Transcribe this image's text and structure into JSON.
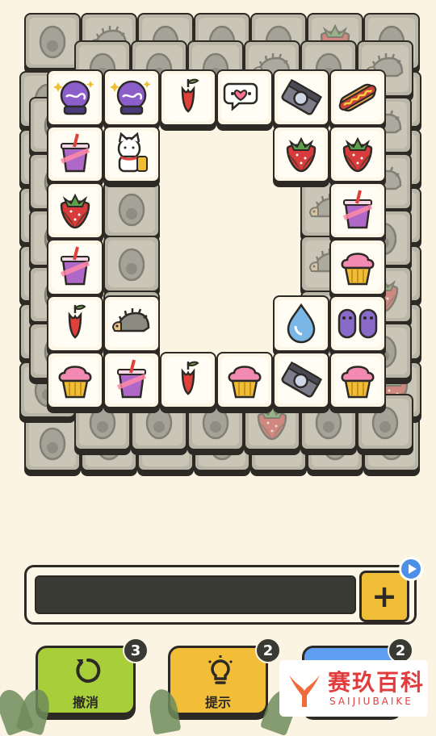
{
  "board": {
    "back_layer": [
      "avocado",
      "hedgehog",
      "cactus",
      "guitar",
      "avocado",
      "strawberry",
      "avocado",
      "cat",
      "avocado",
      "hedgehog"
    ],
    "top_layer": [
      {
        "icon": "crystal-ball-icon",
        "label": "crystal-ball"
      },
      {
        "icon": "crystal-ball-icon",
        "label": "crystal-ball"
      },
      {
        "icon": "red-flower-icon",
        "label": "red-flower"
      },
      {
        "icon": "chat-heart-icon",
        "label": "chat-heart"
      },
      {
        "icon": "camera-icon",
        "label": "camera"
      },
      {
        "icon": "hotdog-icon",
        "label": "hotdog"
      },
      {
        "icon": "bubble-tea-icon",
        "label": "bubble-tea"
      },
      {
        "icon": "lucky-cat-icon",
        "label": "lucky-cat"
      },
      {
        "icon": "strawberry-icon",
        "label": "strawberry"
      },
      {
        "icon": "strawberry-icon",
        "label": "strawberry"
      },
      {
        "icon": "strawberry-icon",
        "label": "strawberry"
      },
      {
        "icon": "bubble-tea-icon",
        "label": "bubble-tea"
      },
      {
        "icon": "bubble-tea-icon",
        "label": "bubble-tea"
      },
      {
        "icon": "cupcake-icon",
        "label": "cupcake"
      },
      {
        "icon": "red-flower-icon",
        "label": "red-flower"
      },
      {
        "icon": "hedgehog-icon",
        "label": "hedgehog"
      },
      {
        "icon": "water-drop-icon",
        "label": "water-drop"
      },
      {
        "icon": "slippers-icon",
        "label": "slippers"
      },
      {
        "icon": "cupcake-icon",
        "label": "cupcake"
      },
      {
        "icon": "bubble-tea-icon",
        "label": "bubble-tea"
      },
      {
        "icon": "red-flower-icon",
        "label": "red-flower"
      },
      {
        "icon": "cupcake-icon",
        "label": "cupcake"
      },
      {
        "icon": "camera-icon",
        "label": "camera"
      },
      {
        "icon": "cupcake-icon",
        "label": "cupcake"
      }
    ]
  },
  "slot_bar": {
    "plus_label": "+"
  },
  "buttons": {
    "undo": {
      "label": "撤消",
      "count": "3",
      "color": "#a8cf3a"
    },
    "hint": {
      "label": "提示",
      "count": "2",
      "color": "#f2be38"
    },
    "shuffle": {
      "count": "2",
      "color": "#5f9ff2"
    }
  },
  "watermark": {
    "cn": "赛玖百科",
    "en": "SAIJIUBAIKE"
  }
}
